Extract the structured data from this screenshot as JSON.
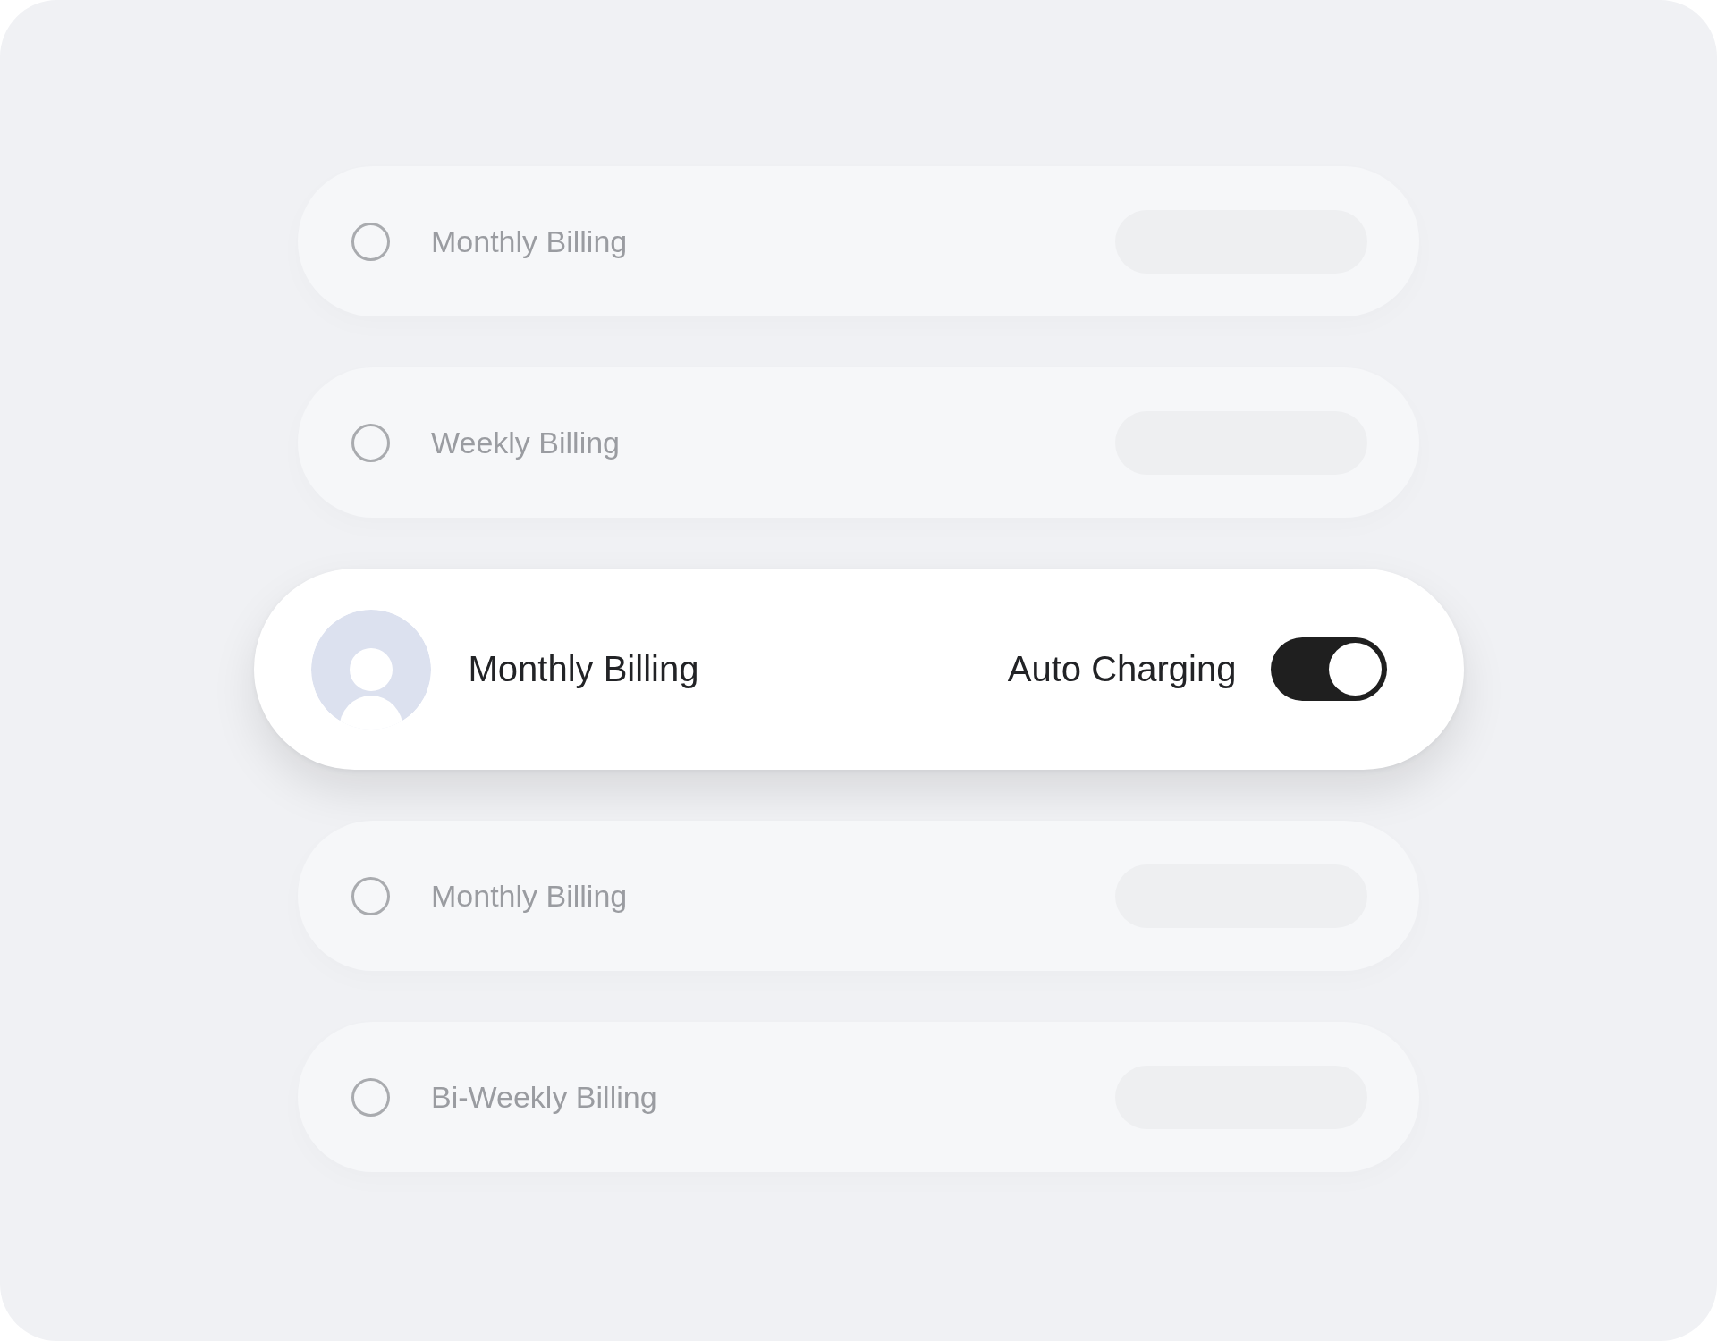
{
  "options": [
    {
      "kind": "option",
      "label": "Monthly Billing",
      "selected": false
    },
    {
      "kind": "option",
      "label": "Weekly Billing",
      "selected": false
    },
    {
      "kind": "active",
      "label": "Monthly Billing",
      "toggle_label": "Auto Charging",
      "on": true
    },
    {
      "kind": "option",
      "label": "Monthly Billing",
      "selected": false
    },
    {
      "kind": "option",
      "label": "Bi-Weekly Billing",
      "selected": false
    }
  ]
}
